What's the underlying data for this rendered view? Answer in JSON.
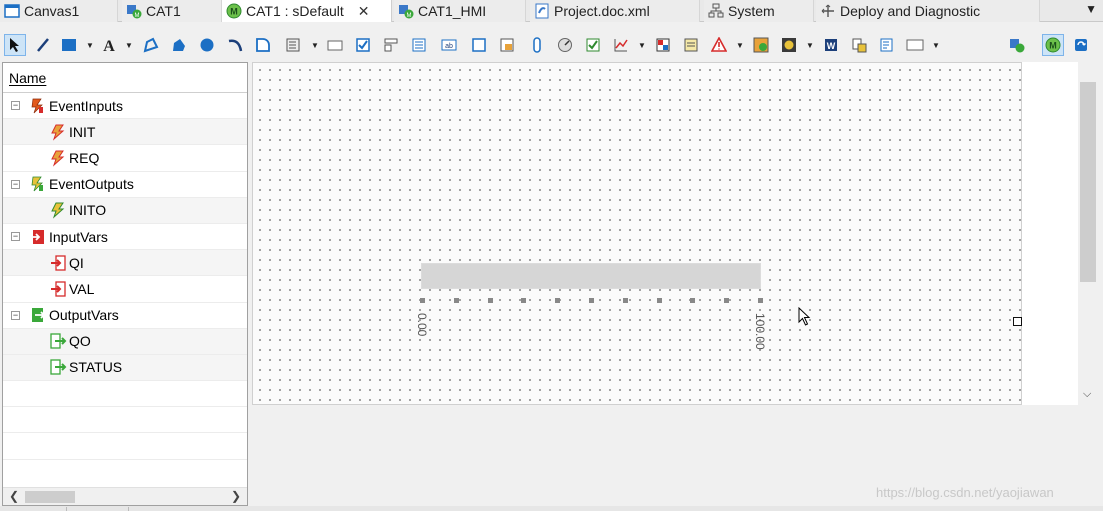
{
  "tabs": [
    {
      "label": "Canvas1",
      "icon": "canvas-icon"
    },
    {
      "label": "CAT1",
      "icon": "cat-icon"
    },
    {
      "label": "CAT1 : sDefault",
      "icon": "m-circle-icon",
      "active": true
    },
    {
      "label": "CAT1_HMI",
      "icon": "cat-icon"
    },
    {
      "label": "Project.doc.xml",
      "icon": "xml-doc-icon"
    },
    {
      "label": "System",
      "icon": "system-icon"
    },
    {
      "label": "Deploy and Diagnostic",
      "icon": "deploy-icon"
    }
  ],
  "tab_close_glyph": "✕",
  "tab_menu_glyph": "▼",
  "tree": {
    "header": "Name",
    "items": [
      {
        "label": "EventInputs",
        "level": 0,
        "icon": "event-inputs-icon"
      },
      {
        "label": "INIT",
        "level": 1,
        "icon": "event-input-icon"
      },
      {
        "label": "REQ",
        "level": 1,
        "icon": "event-input-icon"
      },
      {
        "label": "EventOutputs",
        "level": 0,
        "icon": "event-outputs-icon"
      },
      {
        "label": "INITO",
        "level": 1,
        "icon": "event-output-icon"
      },
      {
        "label": "InputVars",
        "level": 0,
        "icon": "input-vars-icon"
      },
      {
        "label": "QI",
        "level": 1,
        "icon": "input-var-icon"
      },
      {
        "label": "VAL",
        "level": 1,
        "icon": "input-var-icon"
      },
      {
        "label": "OutputVars",
        "level": 0,
        "icon": "output-vars-icon"
      },
      {
        "label": "QO",
        "level": 1,
        "icon": "output-var-icon"
      },
      {
        "label": "STATUS",
        "level": 1,
        "icon": "output-var-icon"
      }
    ]
  },
  "slider": {
    "min_label": "0.00",
    "max_label": "100.00",
    "tick_count": 11
  },
  "watermark": "https://blog.csdn.net/yaojiawan",
  "colors": {
    "accent": "#1c6fc4",
    "event_icon": "#e25a1c",
    "input_icon": "#d62b2b",
    "output_icon": "#3aa83a"
  }
}
